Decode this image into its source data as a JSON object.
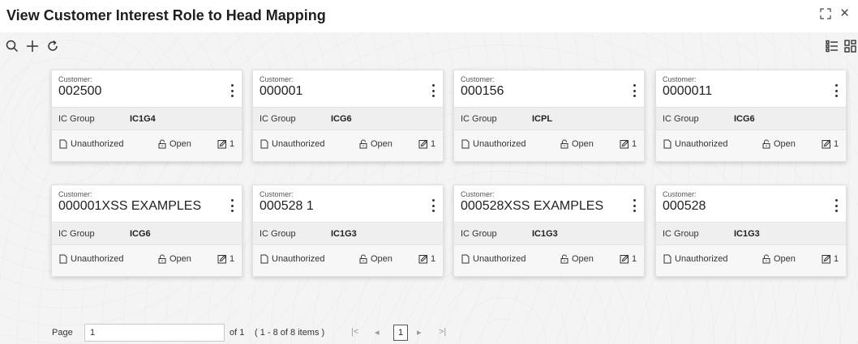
{
  "window": {
    "title": "View Customer Interest Role to Head Mapping",
    "restore_icon": "restore-icon",
    "close_glyph": "×"
  },
  "toolbar": {
    "icons": [
      "search-icon",
      "add-icon",
      "refresh-icon",
      "list-view-icon",
      "grid-view-icon"
    ]
  },
  "cards": [
    {
      "customer_label": "Customer:",
      "customer_id": "002500",
      "group_label": "IC Group",
      "group_value": "IC1G4",
      "status": "Unauthorized",
      "lock": "Open",
      "edit_count": "1"
    },
    {
      "customer_label": "Customer:",
      "customer_id": "000001",
      "group_label": "IC Group",
      "group_value": "ICG6",
      "status": "Unauthorized",
      "lock": "Open",
      "edit_count": "1"
    },
    {
      "customer_label": "Customer:",
      "customer_id": "000156",
      "group_label": "IC Group",
      "group_value": "ICPL",
      "status": "Unauthorized",
      "lock": "Open",
      "edit_count": "1"
    },
    {
      "customer_label": "Customer:",
      "customer_id": "0000011",
      "group_label": "IC Group",
      "group_value": "ICG6",
      "status": "Unauthorized",
      "lock": "Open",
      "edit_count": "1"
    },
    {
      "customer_label": "Customer:",
      "customer_id": "000001XSS EXAMPLES",
      "group_label": "IC Group",
      "group_value": "ICG6",
      "status": "Unauthorized",
      "lock": "Open",
      "edit_count": "1"
    },
    {
      "customer_label": "Customer:",
      "customer_id": "000528 1",
      "group_label": "IC Group",
      "group_value": "IC1G3",
      "status": "Unauthorized",
      "lock": "Open",
      "edit_count": "1"
    },
    {
      "customer_label": "Customer:",
      "customer_id": "000528XSS EXAMPLES",
      "group_label": "IC Group",
      "group_value": "IC1G3",
      "status": "Unauthorized",
      "lock": "Open",
      "edit_count": "1"
    },
    {
      "customer_label": "Customer:",
      "customer_id": "000528",
      "group_label": "IC Group",
      "group_value": "IC1G3",
      "status": "Unauthorized",
      "lock": "Open",
      "edit_count": "1"
    }
  ],
  "pagination": {
    "page_label": "Page",
    "page_value": "1",
    "of_label": "of 1",
    "items_summary": "( 1 - 8 of 8 items )",
    "first_glyph": "|<",
    "prev_glyph": "◂",
    "current_page": "1",
    "next_glyph": "▸",
    "last_glyph": ">|"
  }
}
